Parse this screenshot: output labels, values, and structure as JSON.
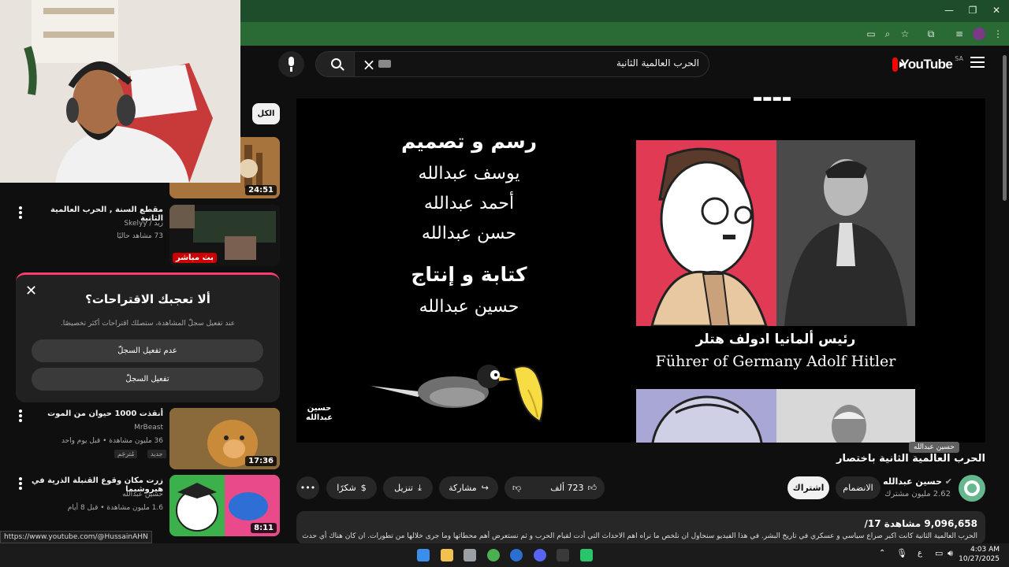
{
  "search": {
    "query": "الحرب العالمية الثانية"
  },
  "logo": {
    "text": "YouTube",
    "region": "SA"
  },
  "player": {
    "credits": {
      "design_heading": "رسم و تصميم",
      "design_names": [
        "يوسف عبدالله",
        "أحمد عبدالله",
        "حسن عبدالله"
      ],
      "writing_heading": "كتابة و إنتاج",
      "writing_names": [
        "حسين عبدالله"
      ]
    },
    "corner_credit_line1": "حسين",
    "corner_credit_line2": "عبدالله",
    "caption_ar": "رئيس ألمانيا ادولف هتلر",
    "caption_en": "Führer of Germany Adolf Hitler"
  },
  "video": {
    "title": "الحرب العالمية الثانية باختصار",
    "channel": "حسين عبدالله",
    "subscribers": "2.62 مليون مشترك",
    "tooltip": "حسين عبدالله",
    "join_label": "الانضمام",
    "subscribe_label": "اشتراك",
    "likes": "723 ألف",
    "share_label": "مشاركة",
    "download_label": "تنزيل",
    "thanks_label": "شكرًا",
    "views": "9,096,658 مشاهدة",
    "age": "17/",
    "description": "الحرب العالمية الثانية كانت اكبر صراع سياسي و عسكري في تاريخ البشر. في هذا الفيديو سنحاول ان نلخص ما نراه اهم الاحداث التي أدت لقيام الحرب و ثم نستعرض أهم محطاتها وما جرى خلالها من تطورات. ان كان هناك أي حدث"
  },
  "sidebar": {
    "chip_all": "الكل",
    "first_duration": "24:51",
    "items": [
      {
        "title": "مقطع السنة , الحرب العالمية الثانية",
        "channel": "زيد / Skelyy",
        "meta": "73 مشاهد حاليًا",
        "badge": "بث مباشر"
      },
      {
        "title": "أنقذت 1000 حيوان من الموت",
        "channel": "MrBeast",
        "meta": "36 مليون مشاهدة • قبل يوم واحد",
        "badge": "جديد",
        "badge2": "مُترجَم",
        "duration": "17:36"
      },
      {
        "title": "زرت مكان وقوع القنبلة الذرية في هيروشيما",
        "channel": "حسين عبدالله",
        "meta": "1.6 مليون مشاهدة • قبل 8 أيام",
        "duration": "8:11"
      }
    ],
    "dismiss_card": {
      "title": "ألا تعجبك الاقتراحات؟",
      "body": "عند تفعيل سجلّ المشاهدة، ستصلك اقتراحات أكثر تخصيصًا.",
      "button1": "عدم تفعيل السجلّ",
      "button2": "تفعيل السجلّ"
    }
  },
  "status_url": "https://www.youtube.com/@HussainAHN",
  "taskbar": {
    "lang": "ع",
    "time": "4:03 AM",
    "date": "10/27/2025"
  }
}
